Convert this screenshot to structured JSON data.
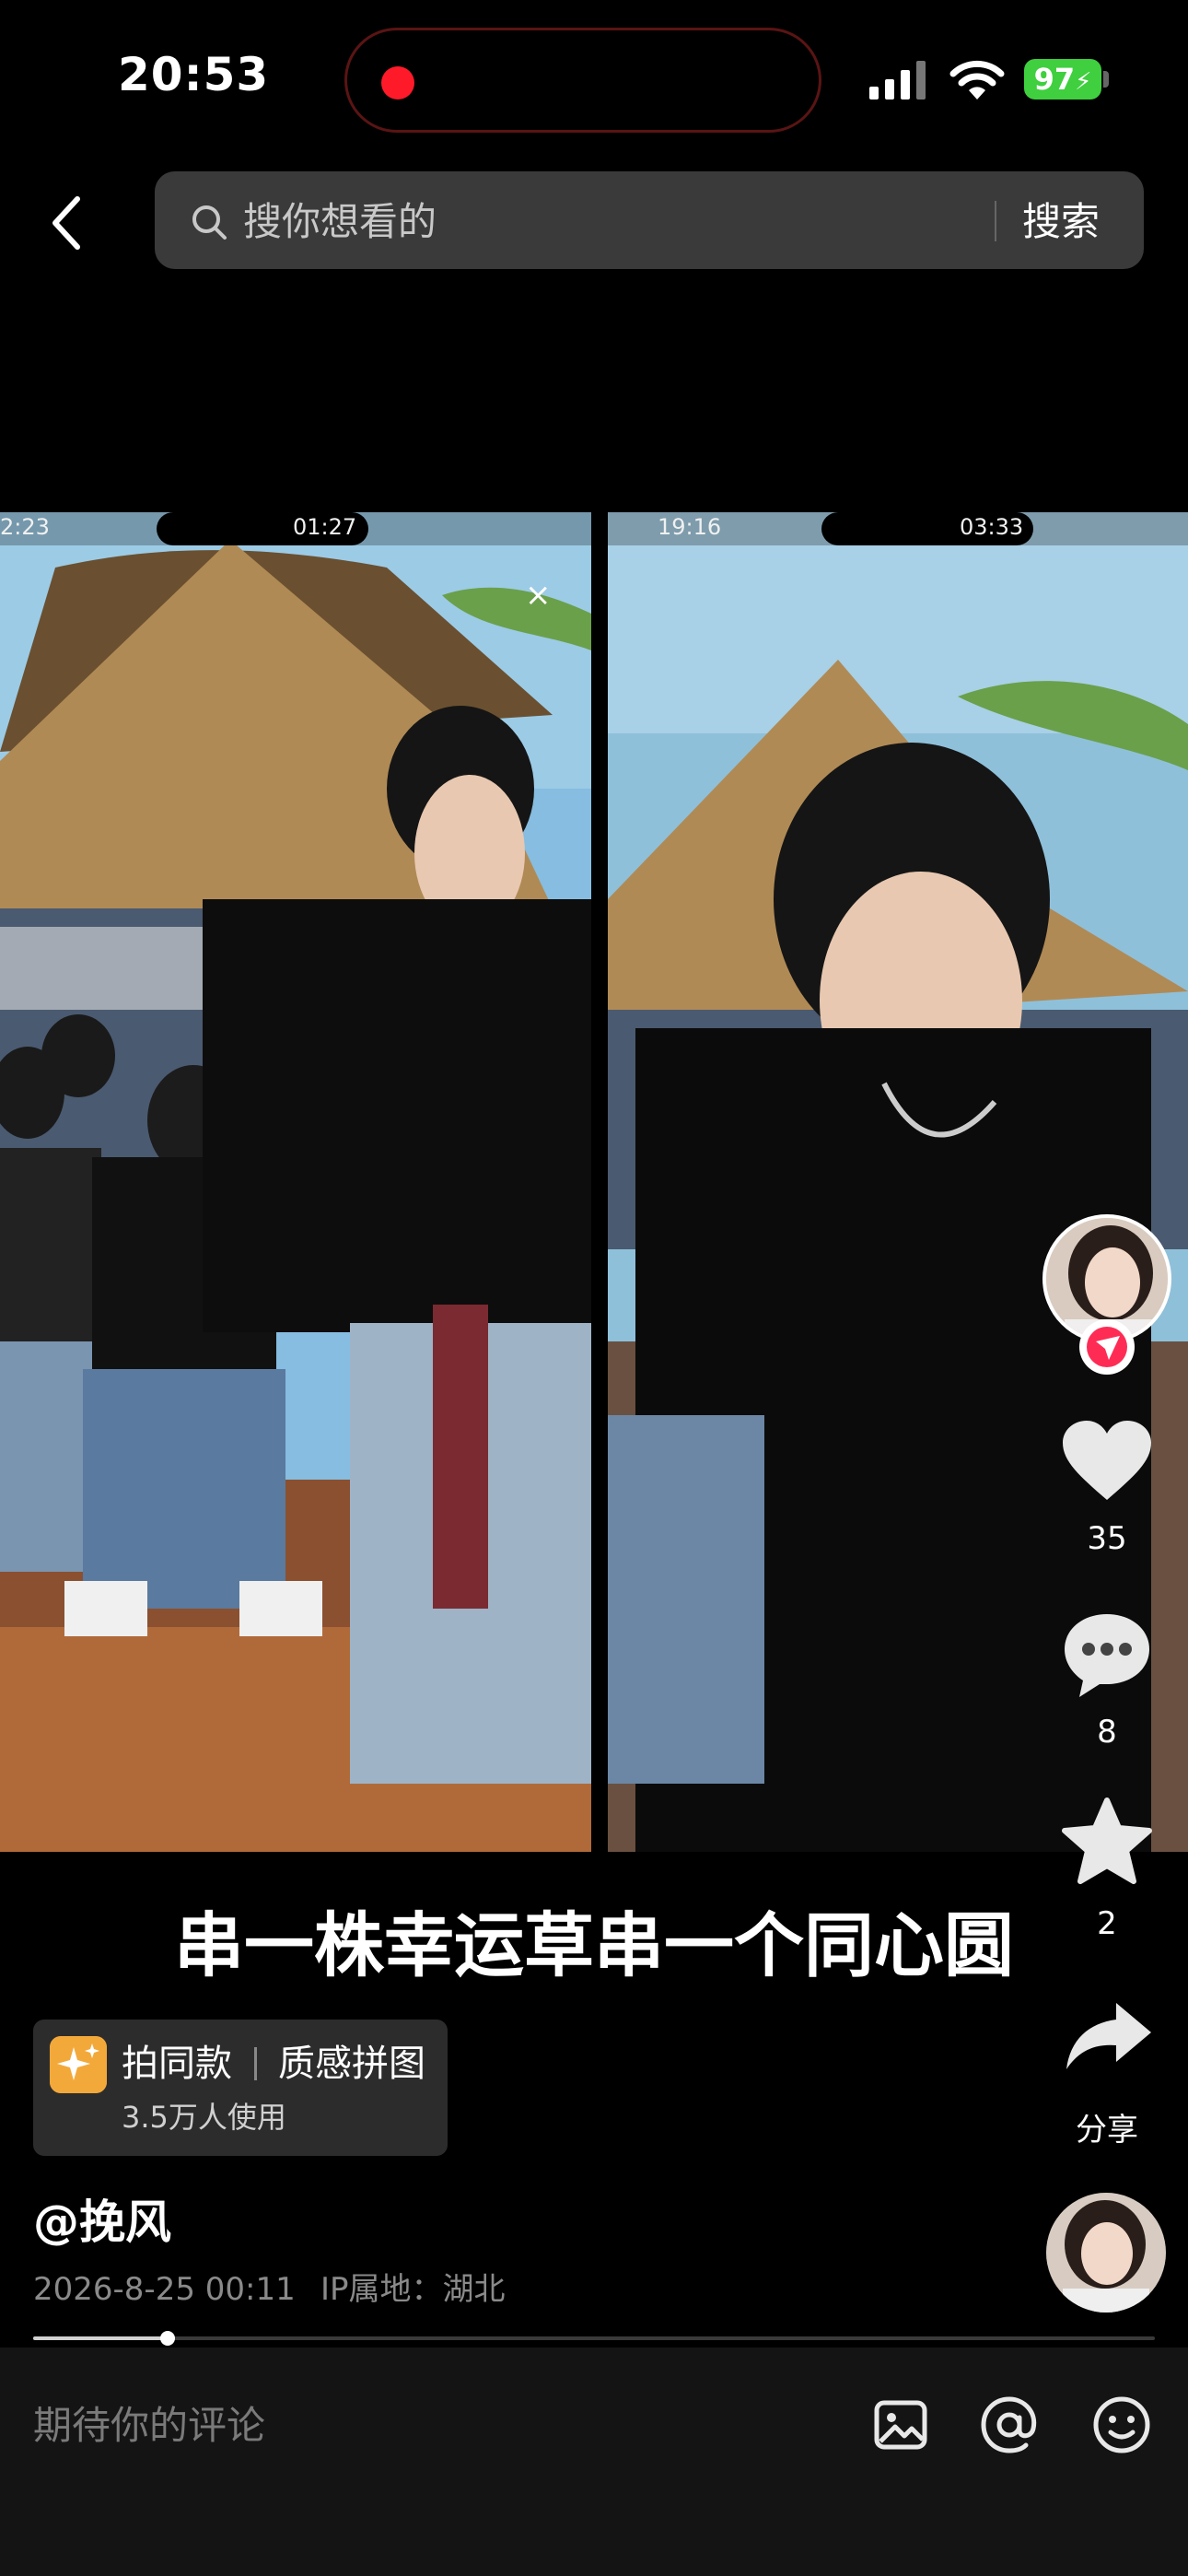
{
  "status_bar": {
    "time": "20:53",
    "battery": "97"
  },
  "search": {
    "placeholder": "搜你想看的",
    "button": "搜索"
  },
  "video": {
    "left_status": {
      "time": "2:23",
      "clock": "01:27"
    },
    "right_status": {
      "time": "19:16",
      "clock": "03:33"
    }
  },
  "caption": "串一株幸运草串一个同心圆",
  "actions": {
    "likes": "35",
    "comments": "8",
    "favorites": "2",
    "share": "分享"
  },
  "template": {
    "left": "拍同款",
    "right": "质感拼图",
    "users": "3.5万人使用"
  },
  "author": {
    "name": "@挽风",
    "date": "2026-8-25 00:11",
    "ip": "IP属地：湖北"
  },
  "progress": {
    "fraction": 0.12
  },
  "comment_bar": {
    "placeholder": "期待你的评论"
  },
  "colors": {
    "like_heart": "#e8e8e8",
    "battery": "#3fcf3f",
    "record": "#ff1a2a"
  }
}
